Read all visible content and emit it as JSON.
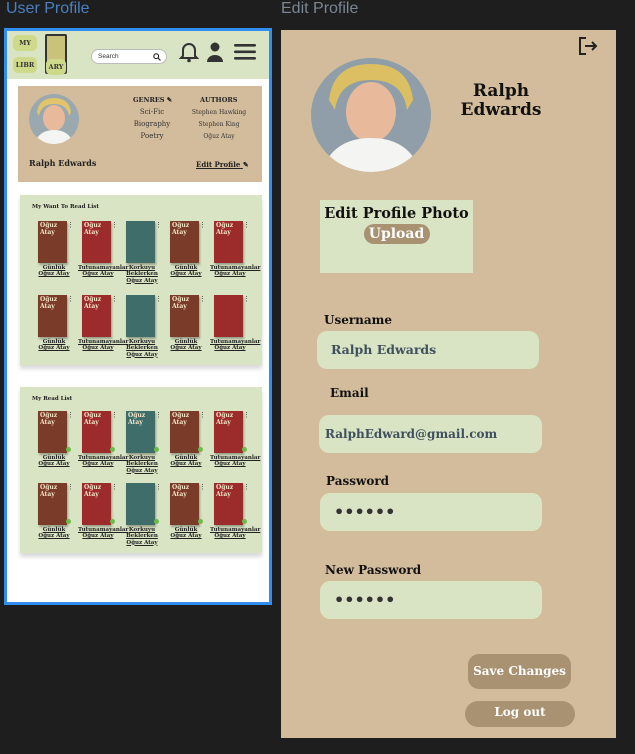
{
  "frames": {
    "left_title": "User Profile",
    "right_title": "Edit Profile"
  },
  "header": {
    "logo_tiles": [
      "MY",
      "LIBR",
      "ARY"
    ],
    "search_placeholder": "Search",
    "icons": [
      "bell-icon",
      "user-icon",
      "menu-icon"
    ]
  },
  "profile_card": {
    "name": "Ralph Edwards",
    "edit_label": "Edit Profile",
    "genres_heading": "GENRES",
    "genres": [
      "Sci-Fic",
      "Biography",
      "Poetry"
    ],
    "authors_heading": "AUTHORS",
    "authors": [
      "Stephen Hawking",
      "Stephen King",
      "Oğuz Atay"
    ]
  },
  "want_list": {
    "title": "My Want To Read List",
    "books": [
      {
        "caption": "Günlük Oğuz Atay",
        "color": "#7a3b28",
        "cover": "Oğuz Atay"
      },
      {
        "caption": "Tutunamayanlar Oğuz Atay",
        "color": "#9c2b2b",
        "cover": "Oğuz Atay"
      },
      {
        "caption": "Korkuyu Beklerken Oğuz Atay",
        "color": "#3f6e6a",
        "cover": ""
      },
      {
        "caption": "Günlük Oğuz Atay",
        "color": "#7a3b28",
        "cover": "Oğuz Atay"
      },
      {
        "caption": "Tutunamayanlar Oğuz Atay",
        "color": "#9c2b2b",
        "cover": "Oğuz Atay"
      },
      {
        "caption": "Günlük Oğuz Atay",
        "color": "#7a3b28",
        "cover": "Oğuz Atay"
      },
      {
        "caption": "Tutunamayanlar Oğuz Atay",
        "color": "#9c2b2b",
        "cover": "Oğuz Atay"
      },
      {
        "caption": "Korkuyu Beklerken Oğuz Atay",
        "color": "#3f6e6a",
        "cover": ""
      },
      {
        "caption": "Günlük Oğuz Atay",
        "color": "#7a3b28",
        "cover": "Oğuz Atay"
      },
      {
        "caption": "Tutunamayanlar Oğuz Atay",
        "color": "#9c2b2b",
        "cover": ""
      }
    ]
  },
  "read_list": {
    "title": "My Read List",
    "books": [
      {
        "caption": "Günlük Oğuz Atay",
        "color": "#7a3b28",
        "cover": "Oğuz Atay"
      },
      {
        "caption": "Tutunamayanlar Oğuz Atay",
        "color": "#9c2b2b",
        "cover": "Oğuz Atay"
      },
      {
        "caption": "Korkuyu Beklerken Oğuz Atay",
        "color": "#3f6e6a",
        "cover": "Oğuz Atay"
      },
      {
        "caption": "Günlük Oğuz Atay",
        "color": "#7a3b28",
        "cover": "Oğuz Atay"
      },
      {
        "caption": "Tutunamayanlar Oğuz Atay",
        "color": "#9c2b2b",
        "cover": "Oğuz Atay"
      },
      {
        "caption": "Günlük Oğuz Atay",
        "color": "#7a3b28",
        "cover": "Oğuz Atay"
      },
      {
        "caption": "Tutunamayanlar Oğuz Atay",
        "color": "#9c2b2b",
        "cover": "Oğuz Atay"
      },
      {
        "caption": "Korkuyu Beklerken Oğuz Atay",
        "color": "#3f6e6a",
        "cover": ""
      },
      {
        "caption": "Günlük Oğuz Atay",
        "color": "#7a3b28",
        "cover": "Oğuz Atay"
      },
      {
        "caption": "Tutunamayanlar Oğuz Atay",
        "color": "#9c2b2b",
        "cover": "Oğuz Atay"
      }
    ]
  },
  "edit": {
    "name": "Ralph Edwards",
    "photo_heading": "Edit Profile Photo",
    "upload_label": "Upload",
    "username_label": "Username",
    "username_value": "Ralph Edwards",
    "email_label": "Email",
    "email_value": "RalphEdward@gmail.com",
    "password_label": "Password",
    "password_value": "••••••",
    "new_password_label": "New Password",
    "new_password_value": "••••••",
    "save_label": "Save Changes",
    "logout_label": "Log out"
  },
  "colors": {
    "accent": "#2f8ef0",
    "tan": "#d3bc9b",
    "sage": "#d9e4c4",
    "button": "#a89272"
  }
}
